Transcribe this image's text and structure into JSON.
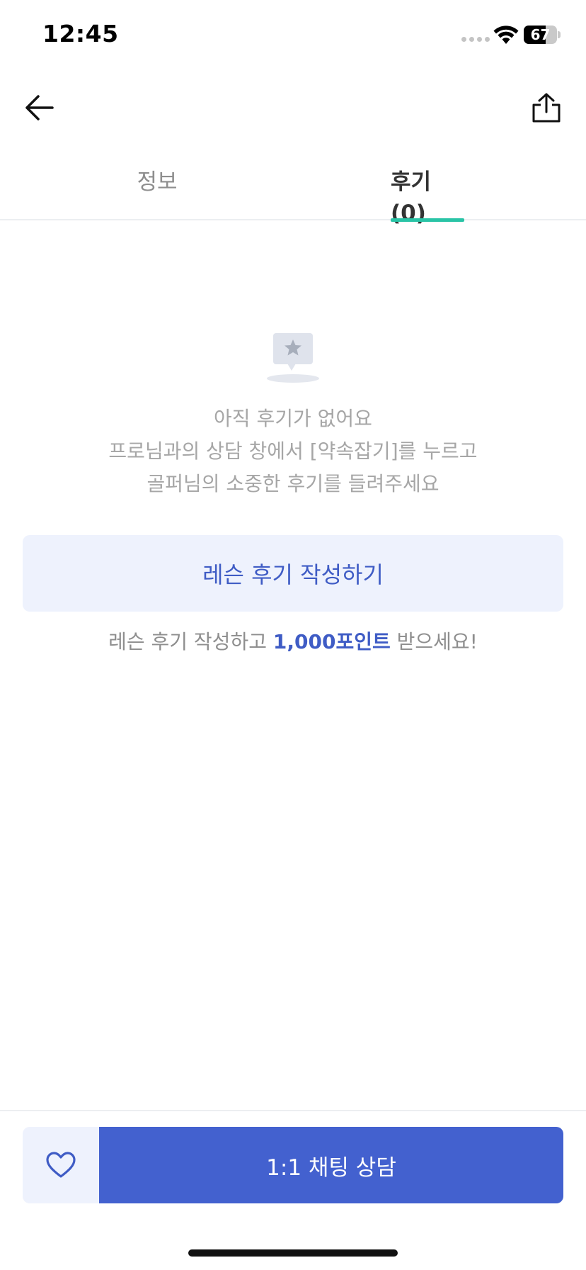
{
  "status_bar": {
    "time": "12:45",
    "battery_text": "67",
    "battery_level": 0.67
  },
  "nav": {
    "back_icon": "arrow-left-icon",
    "share_icon": "share-icon"
  },
  "tabs": [
    {
      "label": "정보",
      "active": false
    },
    {
      "label": "후기(0)",
      "active": true
    }
  ],
  "empty_state": {
    "icon": "review-star-bubble-icon",
    "lines": [
      "아직 후기가 없어요",
      "프로님과의 상담 창에서 [약속잡기]를 누르고",
      "골퍼님의 소중한 후기를 들려주세요"
    ]
  },
  "write_review": {
    "label": "레슨 후기 작성하기"
  },
  "reward": {
    "prefix": "레슨 후기 작성하고 ",
    "highlight": "1,000포인트",
    "suffix": " 받으세요!"
  },
  "bottom_bar": {
    "like_icon": "heart-icon",
    "chat_label": "1:1 채팅 상담"
  },
  "colors": {
    "accent": "#4361cf",
    "tab_indicator": "#29c4a6",
    "light_accent_bg": "#eef2fd"
  }
}
